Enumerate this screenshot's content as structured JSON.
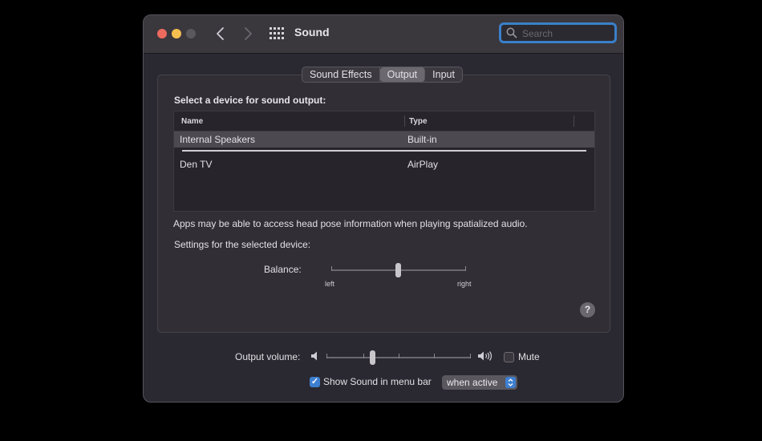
{
  "window": {
    "title": "Sound",
    "search": {
      "placeholder": "Search",
      "value": ""
    }
  },
  "tabs": [
    {
      "label": "Sound Effects",
      "selected": false
    },
    {
      "label": "Output",
      "selected": true
    },
    {
      "label": "Input",
      "selected": false
    }
  ],
  "output": {
    "heading": "Select a device for sound output:",
    "columns": {
      "name": "Name",
      "type": "Type"
    },
    "devices": [
      {
        "name": "Internal Speakers",
        "type": "Built-in",
        "selected": true
      },
      {
        "name": "Den TV",
        "type": "AirPlay",
        "selected": false
      }
    ],
    "info_text": "Apps may be able to access head pose information when playing spatialized audio.",
    "settings_text": "Settings for the selected device:",
    "balance": {
      "label": "Balance:",
      "left_label": "left",
      "right_label": "right",
      "value": 0.5
    },
    "help_label": "?"
  },
  "footer": {
    "volume_label": "Output volume:",
    "volume_value": 0.31,
    "mute_label": "Mute",
    "mute_checked": false,
    "show_in_menubar_label": "Show Sound in menu bar",
    "show_in_menubar_checked": true,
    "menubar_option": "when active"
  },
  "colors": {
    "accent": "#3d7fd0",
    "close": "#ed6a5e",
    "minimize": "#f5bf4f",
    "zoom_disabled": "#5a585d"
  }
}
